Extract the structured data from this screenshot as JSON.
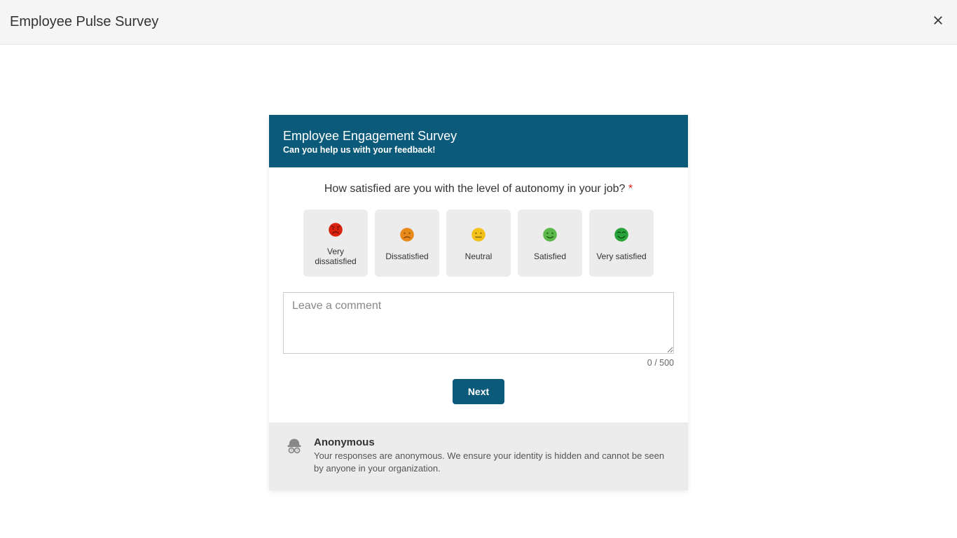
{
  "top": {
    "title": "Employee Pulse Survey"
  },
  "survey": {
    "header": {
      "title": "Employee Engagement Survey",
      "subtitle": "Can you help us with your feedback!"
    },
    "question": {
      "text": "How satisfied are you with the level of autonomy in your job?",
      "required_marker": "*"
    },
    "ratings": [
      {
        "label": "Very dissatisfied",
        "face": "very-dissatisfied",
        "color": "#d9230f"
      },
      {
        "label": "Dissatisfied",
        "face": "dissatisfied",
        "color": "#e88a1b"
      },
      {
        "label": "Neutral",
        "face": "neutral",
        "color": "#f3c21a"
      },
      {
        "label": "Satisfied",
        "face": "satisfied",
        "color": "#5bb84a"
      },
      {
        "label": "Very satisfied",
        "face": "very-satisfied",
        "color": "#2aa43a"
      }
    ],
    "comment": {
      "placeholder": "Leave a comment",
      "value": "",
      "count_text": "0 / 500"
    },
    "next_label": "Next",
    "footer": {
      "title": "Anonymous",
      "desc": "Your responses are anonymous. We ensure your identity is hidden and cannot be seen by anyone in your organization."
    }
  }
}
